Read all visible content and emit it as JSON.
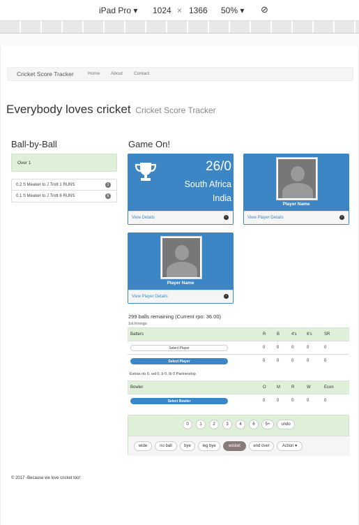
{
  "devtools": {
    "device": "iPad Pro",
    "width": "1024",
    "times": "×",
    "height": "1366",
    "zoom": "50%"
  },
  "navbar": {
    "brand": "Cricket Score Tracker",
    "links": [
      "Home",
      "About",
      "Contact"
    ]
  },
  "header": {
    "title": "Everybody loves cricket",
    "subtitle": "Cricket Score Tracker"
  },
  "ball_by_ball": {
    "heading": "Ball-by-Ball",
    "over_label": "Over 1",
    "items": [
      {
        "text": "0.2 S Meaker to J Trott 1 RUNS",
        "badge": "1"
      },
      {
        "text": "0.1 S Meaker to J Trott 6 RUNS",
        "badge": "6"
      }
    ]
  },
  "game": {
    "heading": "Game On!",
    "score": "26/0",
    "team1": "South Africa",
    "team2": "India",
    "view_details": "View Details",
    "player1_name": "Player Name",
    "player1_details": "View Player Details",
    "player2_name": "Player Name",
    "player2_details": "View Player Details",
    "balls_remaining": "299 balls remaining (Current rpo: 36.00)",
    "innings": "1st Innings"
  },
  "batters_table": {
    "headers": [
      "Batters",
      "R",
      "B",
      "4's",
      "6's",
      "SR"
    ],
    "rows": [
      {
        "select": "Select Player",
        "style": "light",
        "values": [
          "0",
          "0",
          "0",
          "0",
          "0"
        ]
      },
      {
        "select": "Select Player",
        "style": "blue",
        "values": [
          "0",
          "0",
          "0",
          "0",
          "0"
        ]
      }
    ]
  },
  "extras": "Extras nb 0, wd 0, b 0, lb 0 Partnership",
  "bowler_table": {
    "headers": [
      "Bowler",
      "O",
      "M",
      "R",
      "W",
      "Econ"
    ],
    "rows": [
      {
        "select": "Select Bowler",
        "values": [
          "0",
          "0",
          "0",
          "0",
          "0"
        ]
      }
    ]
  },
  "run_buttons": [
    "0",
    "1",
    "2",
    "3",
    "4",
    "6",
    "5+",
    "undo"
  ],
  "event_buttons": [
    "wide",
    "no ball",
    "bye",
    "leg bye",
    "wicket",
    "end over",
    "Action ▾"
  ],
  "footer": "© 2017 -Because we love cricket too!",
  "colors": {
    "primary": "#3d86c6",
    "success_bg": "#dff0d8",
    "wicket_btn": "#8a7b7b"
  }
}
